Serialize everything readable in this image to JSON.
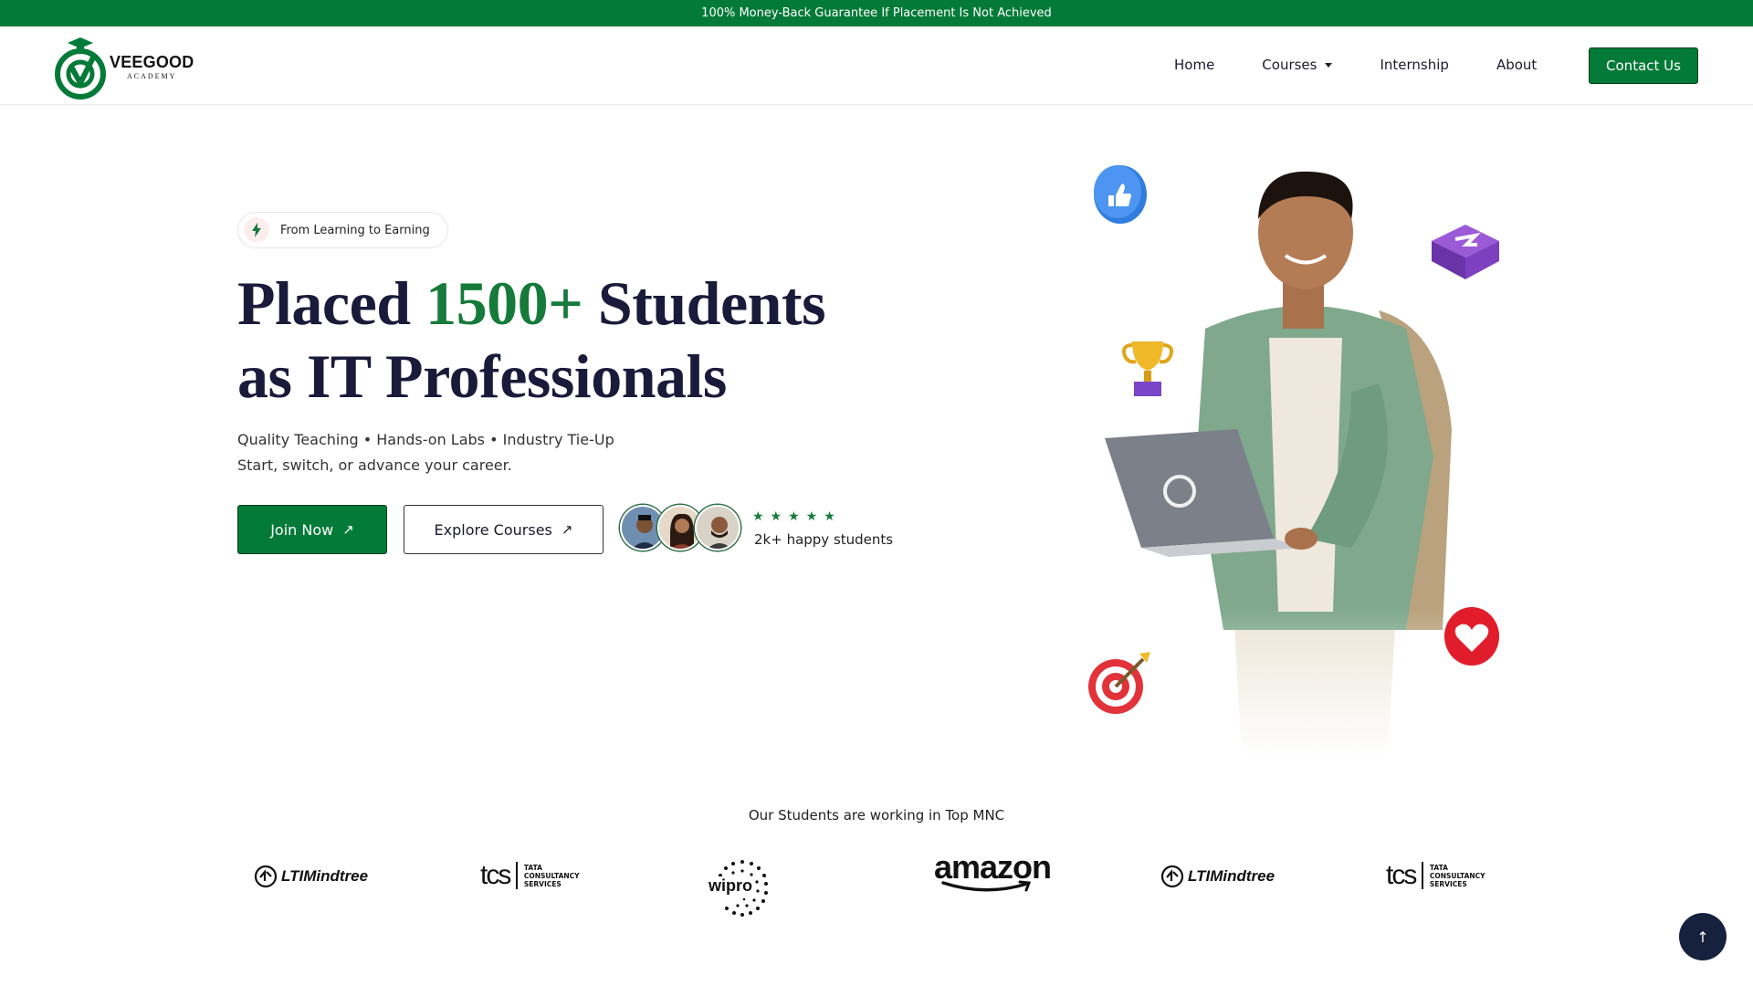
{
  "announcement": "100% Money-Back Guarantee If Placement Is Not Achieved",
  "brand": {
    "name": "VEEGOOD",
    "tagline": "ACADEMY",
    "color": "#047a38"
  },
  "nav": {
    "items": [
      {
        "label": "Home"
      },
      {
        "label": "Courses",
        "dropdown": true
      },
      {
        "label": "Internship"
      },
      {
        "label": "About"
      }
    ],
    "cta": "Contact Us"
  },
  "hero": {
    "badge": "From Learning to Earning",
    "badge_icon": "lightning-icon",
    "headline_part1": "Placed ",
    "headline_highlight": "1500+",
    "headline_part2": " Students",
    "headline_line2": "as IT Professionals",
    "sub1": "Quality Teaching • Hands-on Labs • Industry Tie-Up",
    "sub2": "Start, switch, or advance your career.",
    "join_label": "Join Now",
    "explore_label": "Explore Courses",
    "rating_stars": "★★★★★",
    "rating_text": "2k+ happy students",
    "highlight_color": "#157a3a"
  },
  "mnc": {
    "title": "Our Students are working in Top MNC",
    "logos": [
      {
        "name": "LTIMindtree"
      },
      {
        "name": "tcs",
        "sub1": "TATA",
        "sub2": "CONSULTANCY",
        "sub3": "SERVICES"
      },
      {
        "name": "wipro"
      },
      {
        "name": "amazon"
      },
      {
        "name": "LTIMindtree"
      },
      {
        "name": "tcs",
        "sub1": "TATA",
        "sub2": "CONSULTANCY",
        "sub3": "SERVICES"
      }
    ]
  },
  "scroll_top": "↑"
}
